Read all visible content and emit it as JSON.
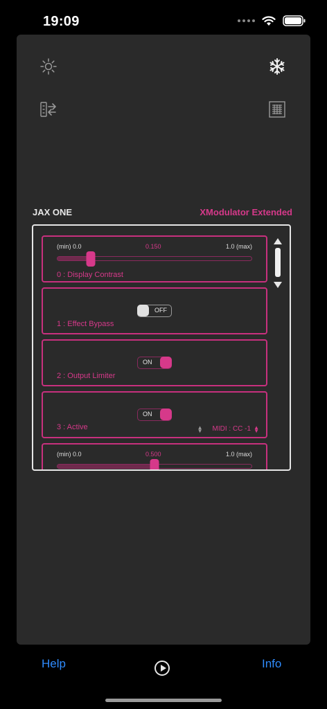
{
  "status_bar": {
    "time": "19:09"
  },
  "header": {
    "device_name": "JAX ONE",
    "plugin_name": "XModulator Extended"
  },
  "toolbar": {
    "icons": [
      "brightness-icon",
      "freeze-icon",
      "transfer-icon",
      "preset-list-icon"
    ]
  },
  "params": [
    {
      "title": "0 : Display Contrast",
      "type": "slider",
      "min_label": "(min) 0.0",
      "max_label": "1.0  (max)",
      "value_label": "0.150",
      "value": 0.15
    },
    {
      "title": "1 : Effect Bypass",
      "type": "toggle",
      "state": "OFF"
    },
    {
      "title": "2 : Output Limiter",
      "type": "toggle",
      "state": "ON"
    },
    {
      "title": "3 : Active",
      "type": "toggle",
      "state": "ON",
      "midi_label": "MIDI : CC -1"
    },
    {
      "title": "",
      "type": "slider",
      "min_label": "(min) 0.0",
      "max_label": "1.0  (max)",
      "value_label": "0.500",
      "value": 0.5
    }
  ],
  "bottom_bar": {
    "help_label": "Help",
    "info_label": "Info"
  },
  "colors": {
    "accent": "#d6398a",
    "link": "#2f8cff",
    "panel": "#2a2a2a"
  }
}
